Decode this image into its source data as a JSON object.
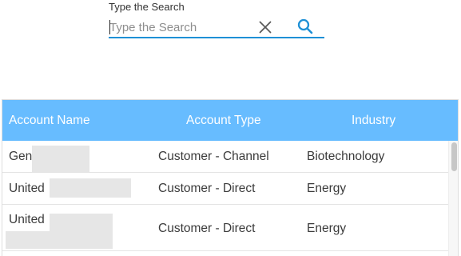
{
  "search": {
    "label": "Type the Search",
    "placeholder": "Type the Search",
    "value": ""
  },
  "icons": {
    "clear": "close-icon",
    "search": "search-icon"
  },
  "colors": {
    "accent": "#1e90d6",
    "header_bg": "#67bcff",
    "header_text": "#ffffff"
  },
  "table": {
    "columns": [
      "Account Name",
      "Account Type",
      "Industry"
    ],
    "rows": [
      {
        "account_name": "Gen",
        "account_type": "Customer - Channel",
        "industry": "Biotechnology"
      },
      {
        "account_name": "United",
        "account_type": "Customer - Direct",
        "industry": "Energy"
      },
      {
        "account_name": "United",
        "account_type": "Customer - Direct",
        "industry": "Energy"
      }
    ]
  }
}
